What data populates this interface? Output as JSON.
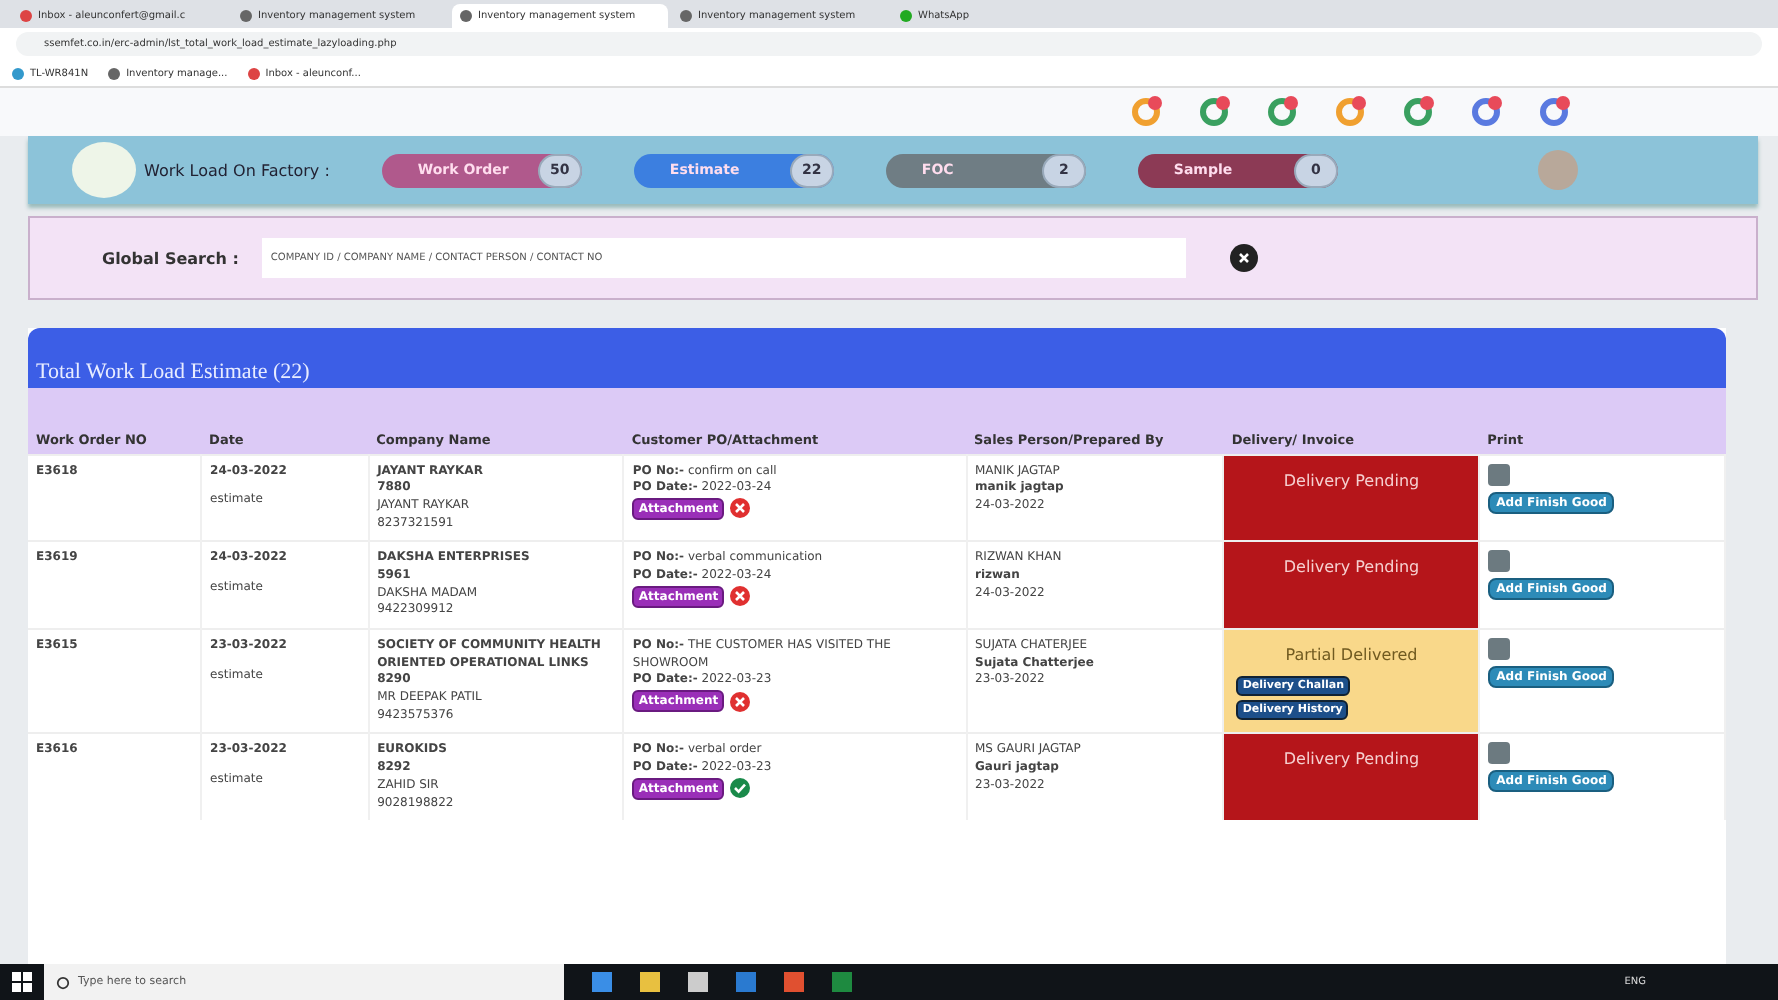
{
  "browser": {
    "tabs": [
      {
        "title": "Inbox - aleunconfert@gmail.c",
        "selected": false,
        "kind": "mail"
      },
      {
        "title": "Inventory management system",
        "selected": false,
        "kind": "site"
      },
      {
        "title": "Inventory management system",
        "selected": true,
        "kind": "site"
      },
      {
        "title": "Inventory management system",
        "selected": false,
        "kind": "site"
      },
      {
        "title": "WhatsApp",
        "selected": false,
        "kind": "chat"
      }
    ],
    "address": "ssemfet.co.in/erc-admin/lst_total_work_load_estimate_lazyloading.php",
    "bookmarks": [
      {
        "label": "TL-WR841N",
        "kind": "router"
      },
      {
        "label": "Inventory manage...",
        "kind": "site"
      },
      {
        "label": "Inbox - aleunconf...",
        "kind": "mail"
      }
    ]
  },
  "notifications": [
    {
      "color": "#f0a030"
    },
    {
      "color": "#3aa060"
    },
    {
      "color": "#3aa060"
    },
    {
      "color": "#f0a030"
    },
    {
      "color": "#3aa060"
    },
    {
      "color": "#5a7ae0"
    },
    {
      "color": "#5a7ae0"
    }
  ],
  "nav": {
    "title": "Work Load On Factory :",
    "pills": [
      {
        "label": "Work Order",
        "count": "50",
        "color": "#b0598c"
      },
      {
        "label": "Estimate",
        "count": "22",
        "color": "#3c7fe0"
      },
      {
        "label": "FOC",
        "count": "2",
        "color": "#6f7d84"
      },
      {
        "label": "Sample",
        "count": "0",
        "color": "#8c3a55"
      }
    ]
  },
  "search": {
    "label": "Global Search :",
    "placeholder": "COMPANY ID / COMPANY NAME / CONTACT PERSON / CONTACT NO"
  },
  "table": {
    "title": "Total Work Load Estimate (22)",
    "columns": [
      "Work Order NO",
      "Date",
      "Company Name",
      "Customer PO/Attachment",
      "Sales Person/Prepared By",
      "Delivery/ Invoice",
      "Print"
    ],
    "rows": [
      {
        "order": "E3618",
        "date": "24-03-2022",
        "type": "estimate",
        "company": "JAYANT RAYKAR",
        "company_id": "7880",
        "contact": "JAYANT RAYKAR",
        "phone": "8237321591",
        "po_no": "**PO No:-** confirm on call",
        "po_date": "**PO Date:-** 2022-03-24",
        "attachment": "Attachment",
        "attached": false,
        "sales": "MANIK JAGTAP",
        "prepared": "manik jagtap",
        "prepared_date": "24-03-2022",
        "delivery": {
          "kind": "pending",
          "status": "Delivery Pending"
        },
        "action": "Add Finish Good"
      },
      {
        "order": "E3619",
        "date": "24-03-2022",
        "type": "estimate",
        "company": "DAKSHA ENTERPRISES",
        "company_id": "5961",
        "contact": "DAKSHA MADAM",
        "phone": "9422309912",
        "po_no": "**PO No:-** verbal communication",
        "po_date": "**PO Date:-** 2022-03-24",
        "attachment": "Attachment",
        "attached": false,
        "sales": "RIZWAN KHAN",
        "prepared": "rizwan",
        "prepared_date": "24-03-2022",
        "delivery": {
          "kind": "pending",
          "status": "Delivery Pending"
        },
        "action": "Add Finish Good"
      },
      {
        "order": "E3615",
        "date": "23-03-2022",
        "type": "estimate",
        "company": "SOCIETY OF COMMUNITY HEALTH ORIENTED OPERATIONAL LINKS",
        "company_id": "8290",
        "contact": "MR DEEPAK PATIL",
        "phone": "9423575376",
        "po_no": "**PO No:-** THE CUSTOMER HAS VISITED THE SHOWROOM",
        "po_date": "**PO Date:-** 2022-03-23",
        "attachment": "Attachment",
        "attached": false,
        "sales": "SUJATA CHATERJEE",
        "prepared": "Sujata Chatterjee",
        "prepared_date": "23-03-2022",
        "delivery": {
          "kind": "partial",
          "status": "Partial Delivered",
          "buttons": [
            "Delivery Challan",
            "Delivery History"
          ]
        },
        "action": "Add Finish Good"
      },
      {
        "order": "E3616",
        "date": "23-03-2022",
        "type": "estimate",
        "company": "EUROKIDS",
        "company_id": "8292",
        "contact": "ZAHID SIR",
        "phone": "9028198822",
        "po_no": "**PO No:-** verbal order",
        "po_date": "**PO Date:-** 2022-03-23",
        "attachment": "Attachment",
        "attached": true,
        "sales": "MS GAURI JAGTAP",
        "prepared": "Gauri jagtap",
        "prepared_date": "23-03-2022",
        "delivery": {
          "kind": "pending",
          "status": "Delivery Pending"
        },
        "action": "Add Finish Good"
      }
    ]
  },
  "taskbar": {
    "search_placeholder": "Type here to search",
    "language": "ENG"
  }
}
